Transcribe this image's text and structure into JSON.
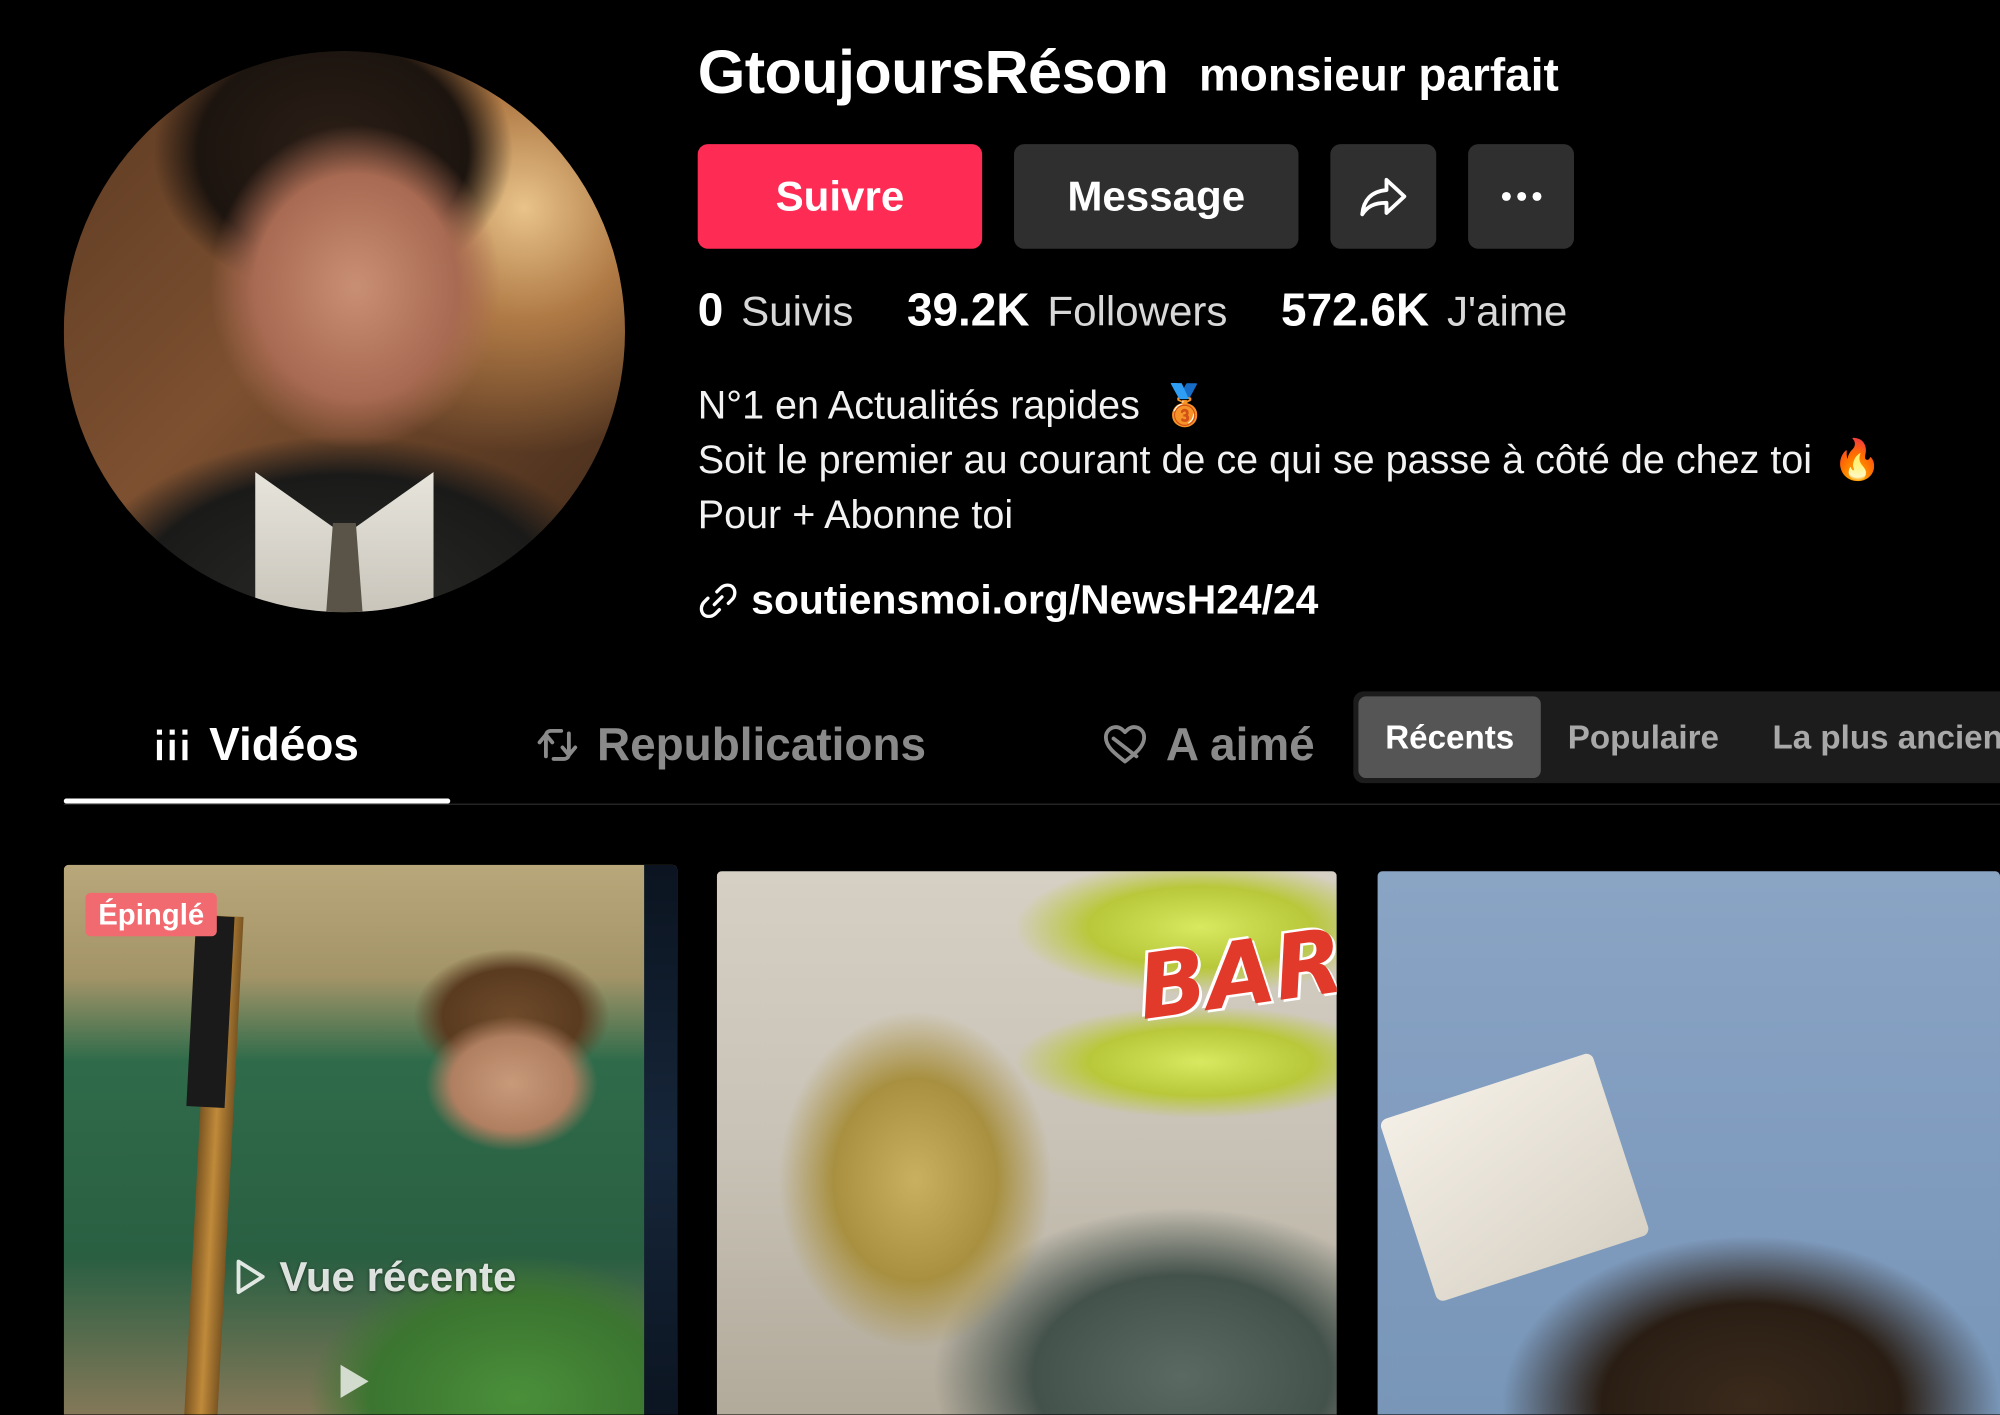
{
  "profile": {
    "username": "GtoujoursRéson",
    "nickname": "monsieur parfait",
    "avatar_icon": "profile-photo"
  },
  "actions": {
    "follow_label": "Suivre",
    "message_label": "Message",
    "share_icon": "share-icon",
    "more_icon": "more-icon"
  },
  "stats": {
    "following_count": "0",
    "following_label": "Suivis",
    "followers_count": "39.2K",
    "followers_label": "Followers",
    "likes_count": "572.6K",
    "likes_label": "J'aime"
  },
  "bio": {
    "line1": "N°1 en Actualités rapides",
    "line1_emoji": "🥉",
    "line2": "Soit le premier au courant de ce qui se passe à côté de chez toi",
    "line2_emoji": "🔥",
    "line3": "Pour + Abonne toi"
  },
  "link": {
    "text": "soutiensmoi.org/NewsH24/24",
    "icon": "link-icon"
  },
  "tabs": [
    {
      "label": "Vidéos",
      "icon": "grid-icon",
      "active": true
    },
    {
      "label": "Republications",
      "icon": "repost-icon",
      "active": false
    },
    {
      "label": "A aimé",
      "icon": "heart-hidden-icon",
      "active": false
    }
  ],
  "sort": {
    "options": [
      "Récents",
      "Populaire",
      "La plus ancienne"
    ],
    "selected": "Récents"
  },
  "videos": [
    {
      "badge": "Épinglé",
      "overlay": "Vue récente"
    },
    {
      "badge": "",
      "overlay": ""
    },
    {
      "badge": "",
      "overlay": ""
    }
  ],
  "colors": {
    "follow_button": "#fe2c55",
    "secondary_button": "#2f2f2f",
    "pinned_badge": "#f06a70",
    "background": "#000000"
  }
}
